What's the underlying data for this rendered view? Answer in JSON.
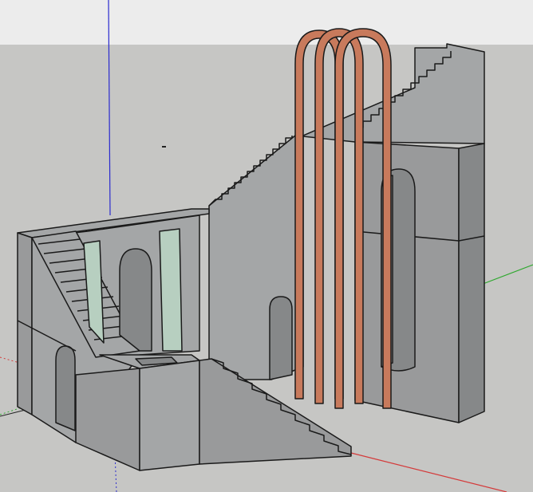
{
  "viewport": {
    "sky_color": "#ECECEC",
    "ground_color": "#C6C6C4",
    "axis_colors": {
      "red": "#D43A3A",
      "green": "#2FA82F",
      "blue": "#2A2ACF"
    },
    "model": {
      "wall_color": "#999A9B",
      "wall_light_color": "#A4A6A7",
      "wall_dark_color": "#868889",
      "edge_color": "#1A1A1A",
      "arch_color": "#C87A5C",
      "glass_color": "#B7CFC0"
    }
  }
}
